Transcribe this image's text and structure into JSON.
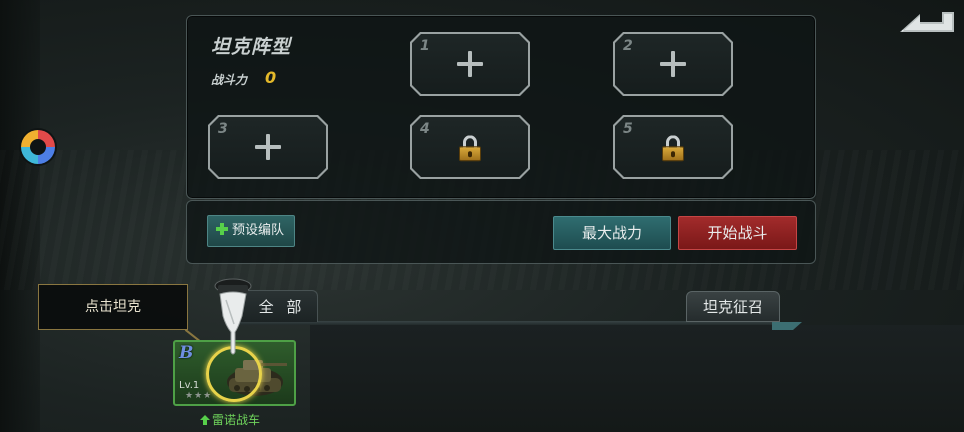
{
  "formation": {
    "title": "坦克阵型",
    "power_label": "战斗力",
    "power_value": "0",
    "slots": [
      {
        "num": "1",
        "state": "empty"
      },
      {
        "num": "2",
        "state": "empty"
      },
      {
        "num": "3",
        "state": "empty"
      },
      {
        "num": "4",
        "state": "locked"
      },
      {
        "num": "5",
        "state": "locked"
      }
    ]
  },
  "actions": {
    "preset_label": "预设编队",
    "max_power_label": "最大战力",
    "start_battle_label": "开始战斗"
  },
  "tabs": {
    "all_label": "全 部",
    "recruit_label": "坦克征召"
  },
  "tooltip": {
    "text": "点击坦克"
  },
  "tank": {
    "grade": "B",
    "level": "Lv.1",
    "stars": "★★★",
    "name": "雷诺战车"
  },
  "colors": {
    "accent_gold": "#e4b92a",
    "start_red": "#a22b2b",
    "teal": "#2f6d70",
    "card_green": "#4ea046"
  }
}
